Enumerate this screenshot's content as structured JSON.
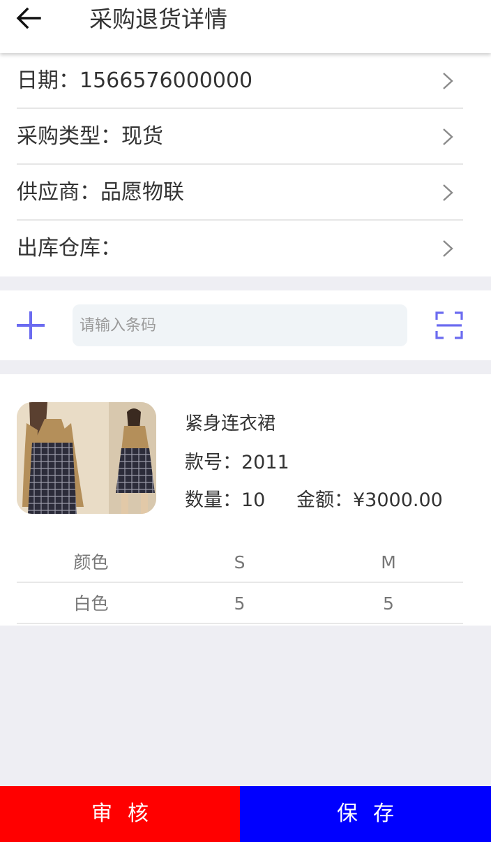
{
  "header": {
    "title": "采购退货详情"
  },
  "icons": {
    "back": "arrow-left-icon",
    "chevron": "chevron-right-icon",
    "add": "plus-icon",
    "scan": "scan-frame-icon"
  },
  "colors": {
    "accent": "#6b6bf0",
    "audit_button": "#ff0000",
    "save_button": "#0000ff"
  },
  "info": {
    "date": "日期：1566576000000",
    "purchase_type": "采购类型：现货",
    "supplier": "供应商：品愿物联",
    "warehouse": "出库仓库："
  },
  "barcode": {
    "placeholder": "请输入条码"
  },
  "product": {
    "name": "紧身连衣裙",
    "code": "款号：2011",
    "quantity": "数量：10",
    "amount": "金额：¥3000.00"
  },
  "size_table": {
    "headers": [
      "颜色",
      "S",
      "M"
    ],
    "rows": [
      [
        "白色",
        "5",
        "5"
      ]
    ]
  },
  "footer": {
    "audit_label": "审核",
    "save_label": "保存"
  }
}
